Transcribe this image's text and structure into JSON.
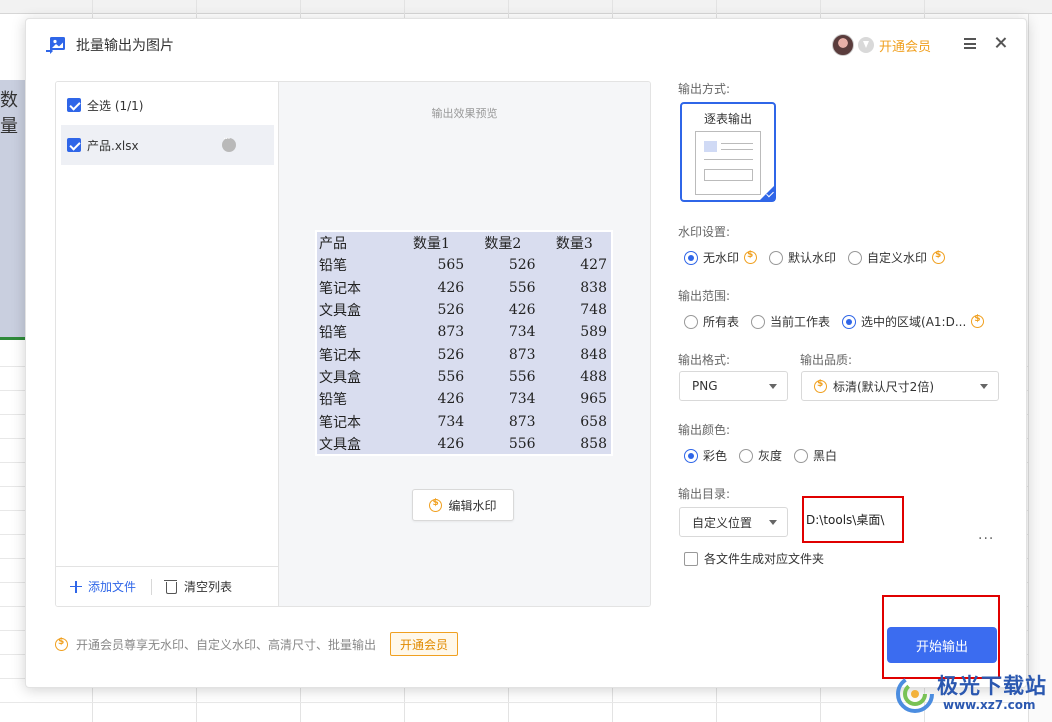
{
  "background": {
    "cell_text": "数量"
  },
  "dialog": {
    "title": "批量输出为图片",
    "vip_link": "开通会员",
    "file_list": {
      "select_all": "全选 (1/1)",
      "files": [
        "产品.xlsx"
      ],
      "add_file": "添加文件",
      "clear_list": "清空列表"
    },
    "preview": {
      "caption": "输出效果预览",
      "table": {
        "headers": [
          "产品",
          "数量1",
          "数量2",
          "数量3"
        ],
        "rows": [
          [
            "铅笔",
            "565",
            "526",
            "427"
          ],
          [
            "笔记本",
            "426",
            "556",
            "838"
          ],
          [
            "文具盒",
            "526",
            "426",
            "748"
          ],
          [
            "铅笔",
            "873",
            "734",
            "589"
          ],
          [
            "笔记本",
            "526",
            "873",
            "848"
          ],
          [
            "文具盒",
            "556",
            "556",
            "488"
          ],
          [
            "铅笔",
            "426",
            "734",
            "965"
          ],
          [
            "笔记本",
            "734",
            "873",
            "658"
          ],
          [
            "文具盒",
            "426",
            "556",
            "858"
          ]
        ]
      },
      "edit_watermark": "编辑水印"
    },
    "settings": {
      "output_mode_label": "输出方式:",
      "output_mode_option": "逐表输出",
      "watermark_label": "水印设置:",
      "watermark_options": [
        "无水印",
        "默认水印",
        "自定义水印"
      ],
      "range_label": "输出范围:",
      "range_options": [
        "所有表",
        "当前工作表",
        "选中的区域(A1:D..."
      ],
      "format_label": "输出格式:",
      "format_value": "PNG",
      "quality_label": "输出品质:",
      "quality_value": "标清(默认尺寸2倍)",
      "color_label": "输出颜色:",
      "color_options": [
        "彩色",
        "灰度",
        "黑白"
      ],
      "dir_label": "输出目录:",
      "dir_select": "自定义位置",
      "dir_path": "D:\\tools\\桌面\\",
      "subfolder_checkbox": "各文件生成对应文件夹"
    },
    "footer": {
      "note": "开通会员尊享无水印、自定义水印、高清尺寸、批量输出",
      "vip_button": "开通会员",
      "start_button": "开始输出"
    }
  },
  "watermark_logo": {
    "text": "极光下载站",
    "url": "www.xz7.com"
  },
  "colors": {
    "accent": "#2f66e8",
    "vip": "#f0a020",
    "highlight": "#e00000",
    "preview_fill": "#d9ddef"
  }
}
